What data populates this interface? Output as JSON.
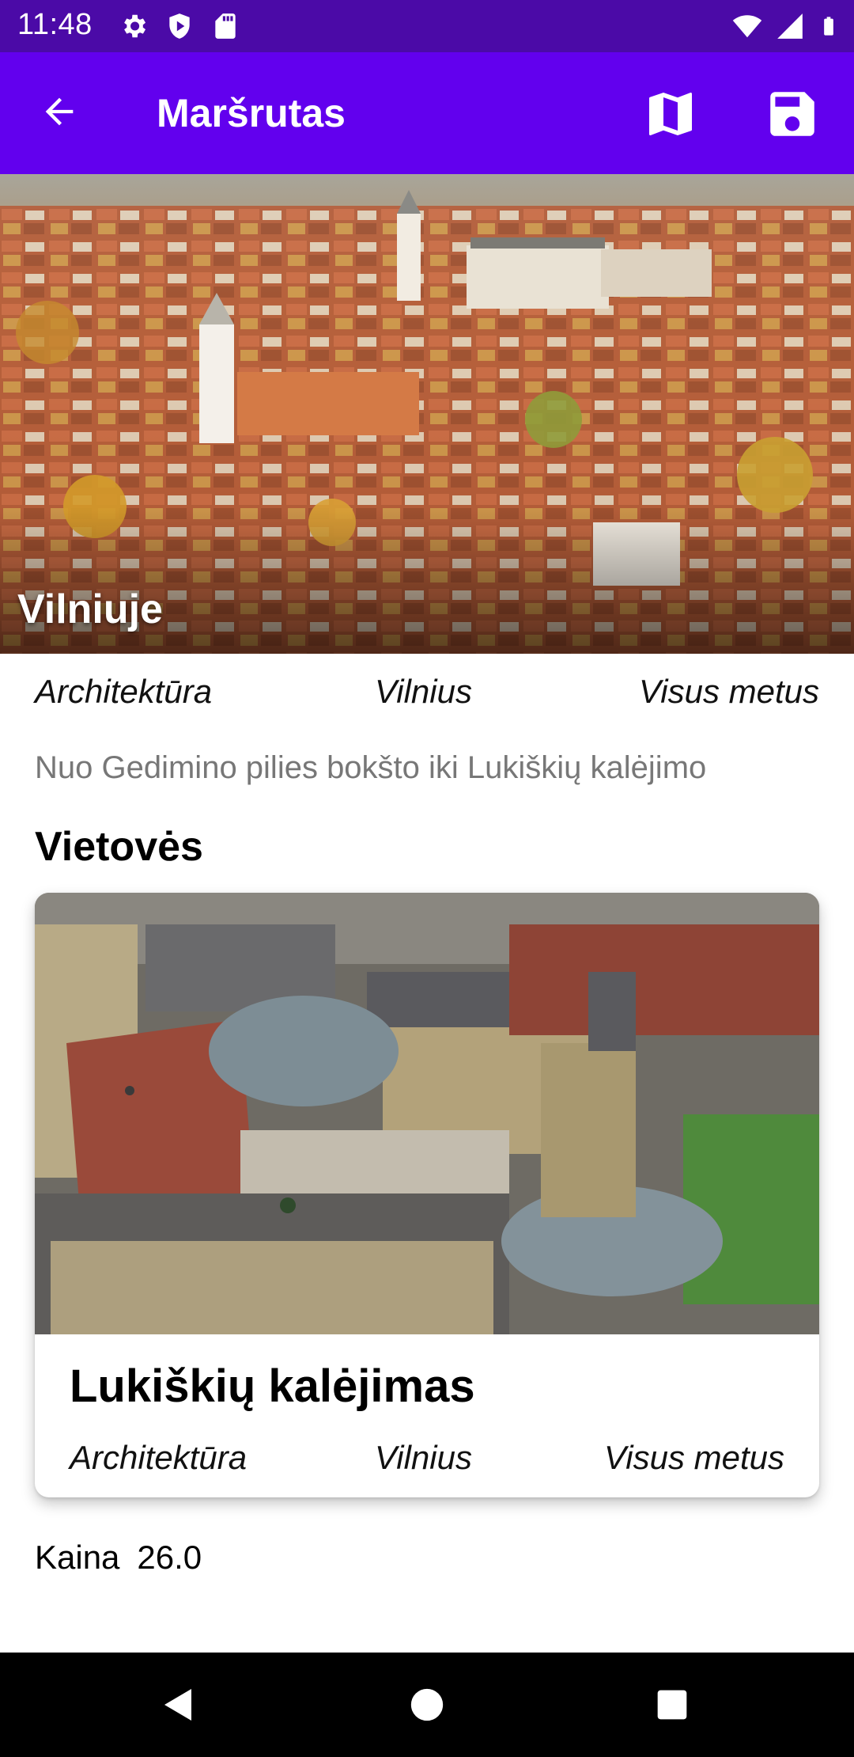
{
  "status_bar": {
    "time": "11:48",
    "left_icons": [
      "settings-icon",
      "shield-icon",
      "sd-card-icon"
    ],
    "right_icons": [
      "wifi-icon",
      "signal-icon",
      "battery-icon"
    ],
    "color": "#4b0aa7"
  },
  "app_bar": {
    "title": "Maršrutas",
    "back_icon": "arrow-back-icon",
    "actions": [
      "map-icon",
      "save-icon"
    ],
    "color": "#6200ee"
  },
  "route": {
    "title": "Vilniuje",
    "category": "Architektūra",
    "city": "Vilnius",
    "season": "Visus metus",
    "description": "Nuo Gedimino pilies bokšto iki Lukiškių kalėjimo"
  },
  "locations_section": {
    "title": "Vietovės",
    "items": [
      {
        "name": "Lukiškių kalėjimas",
        "category": "Architektūra",
        "city": "Vilnius",
        "season": "Visus metus"
      }
    ]
  },
  "price": {
    "label": "Kaina",
    "value": "26.0"
  },
  "nav_bar": {
    "buttons": [
      "back-triangle-icon",
      "home-circle-icon",
      "recents-square-icon"
    ]
  }
}
